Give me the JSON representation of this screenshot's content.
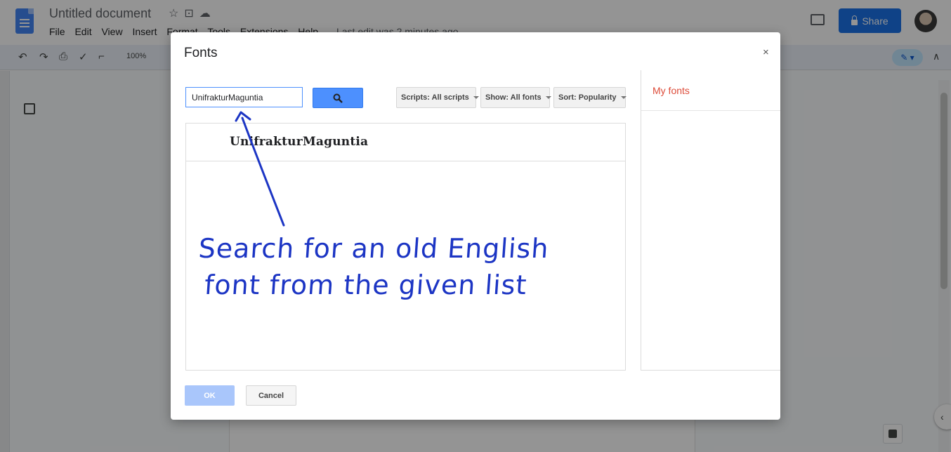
{
  "app": {
    "doc_title": "Untitled document",
    "menus": [
      "File",
      "Edit",
      "View",
      "Insert",
      "Format",
      "Tools",
      "Extensions",
      "Help"
    ],
    "last_edit": "Last edit was 2 minutes ago",
    "share_label": "Share",
    "zoom": "100%"
  },
  "dialog": {
    "title": "Fonts",
    "close": "×",
    "search_value": "UnifrakturMaguntia",
    "filters": {
      "scripts": "Scripts: All scripts",
      "show": "Show: All fonts",
      "sort": "Sort: Popularity"
    },
    "results": [
      "UnifrakturMaguntia"
    ],
    "my_fonts_title": "My fonts",
    "ok_label": "OK",
    "cancel_label": "Cancel"
  },
  "annotation": {
    "line1": "Search for an old English",
    "line2": "font from the given list",
    "color": "#1c35c4"
  }
}
